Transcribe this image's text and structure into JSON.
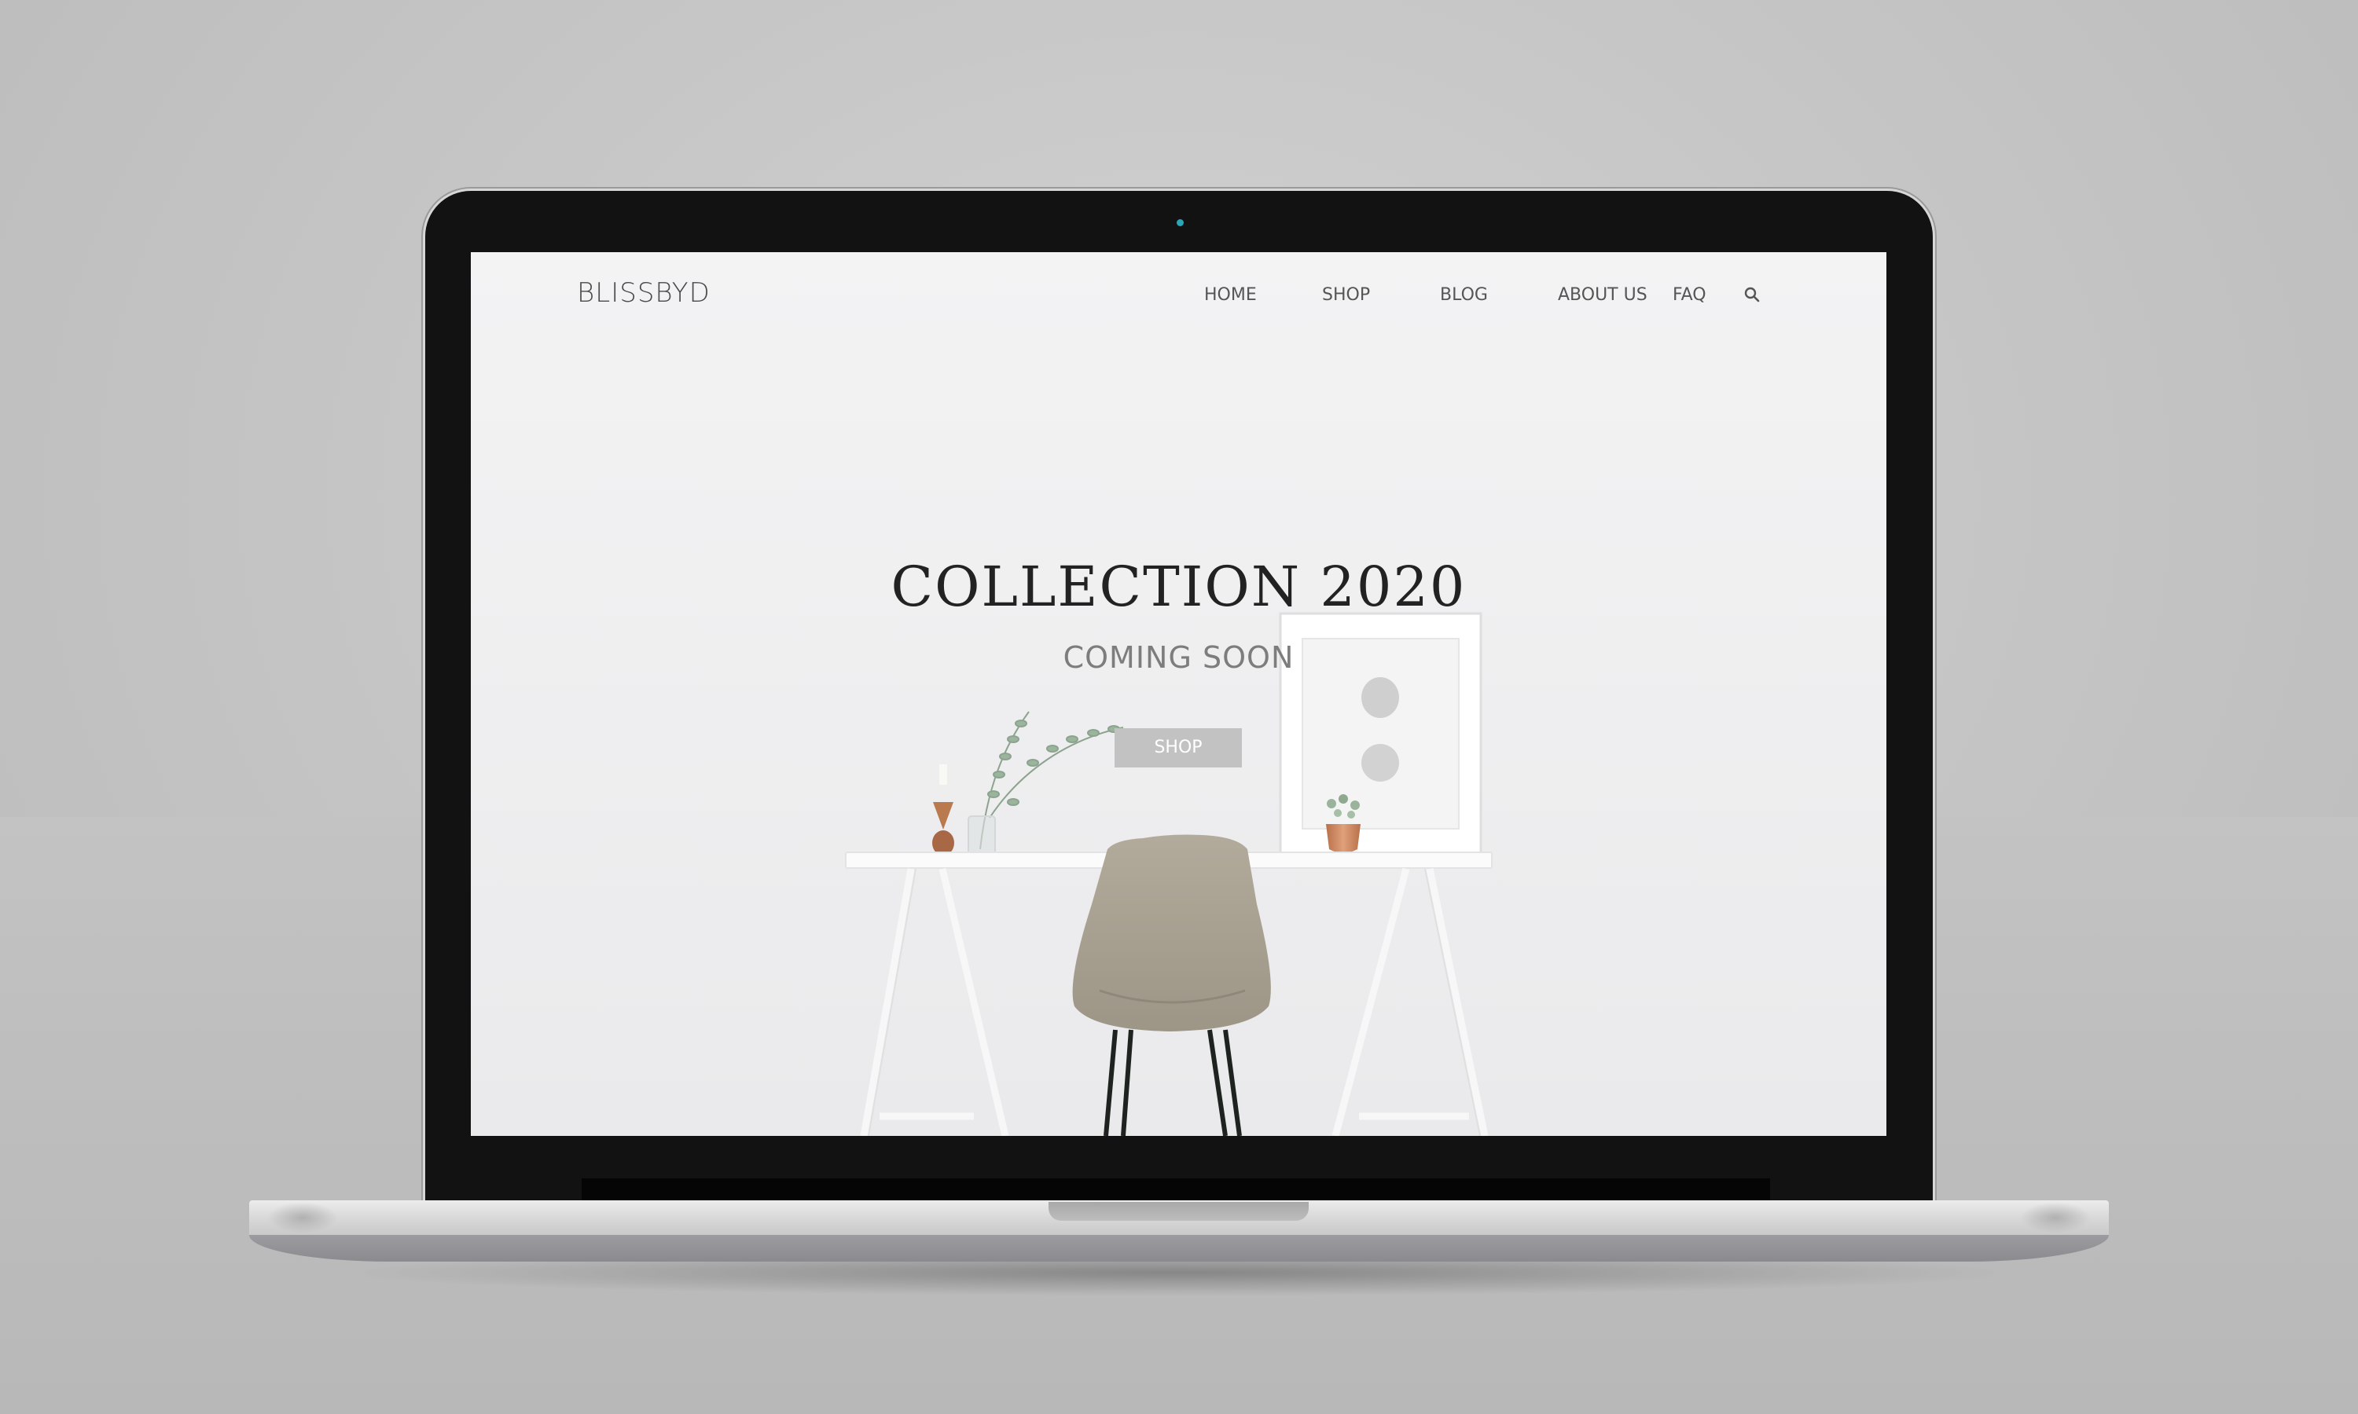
{
  "site": {
    "brand": "BLISSBYD",
    "nav": {
      "home": "HOME",
      "shop": "SHOP",
      "blog": "BLOG",
      "about": "ABOUT US",
      "faq": "FAQ"
    },
    "search_icon": "search-icon"
  },
  "hero": {
    "title": "COLLECTION 2020",
    "subtitle": "COMING SOON",
    "button_label": "SHOP"
  },
  "colors": {
    "screen_bg": "#efeff1",
    "laptop_bezel": "#121212",
    "button_bg": "#c2c2c2",
    "camera_dot": "#2aa6b8",
    "chair": "#aba393",
    "copper": "#c98a63"
  }
}
